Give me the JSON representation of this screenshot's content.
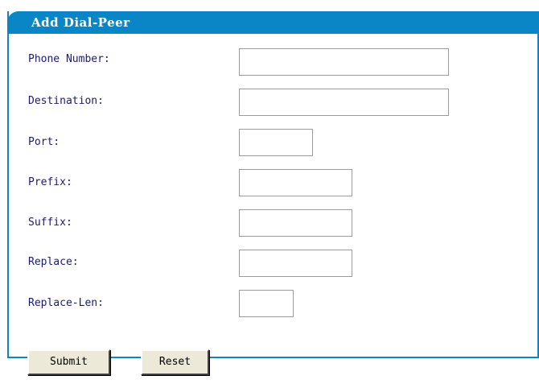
{
  "panel": {
    "title": "Add Dial-Peer"
  },
  "form": {
    "phone_number_label": "Phone Number:",
    "destination_label": "Destination:",
    "port_label": "Port:",
    "prefix_label": "Prefix:",
    "suffix_label": "Suffix:",
    "replace_label": "Replace:",
    "replace_len_label": "Replace-Len:",
    "phone_number_value": "",
    "destination_value": "",
    "port_value": "",
    "prefix_value": "",
    "suffix_value": "",
    "replace_value": "",
    "replace_len_value": ""
  },
  "buttons": {
    "submit_label": "Submit",
    "reset_label": "Reset"
  },
  "colors": {
    "header_background": "#0a86c6",
    "header_text": "#ffffff",
    "label_text": "#1a1a6e",
    "field_border": "#9a9a9a",
    "button_face": "#ece9d8"
  }
}
